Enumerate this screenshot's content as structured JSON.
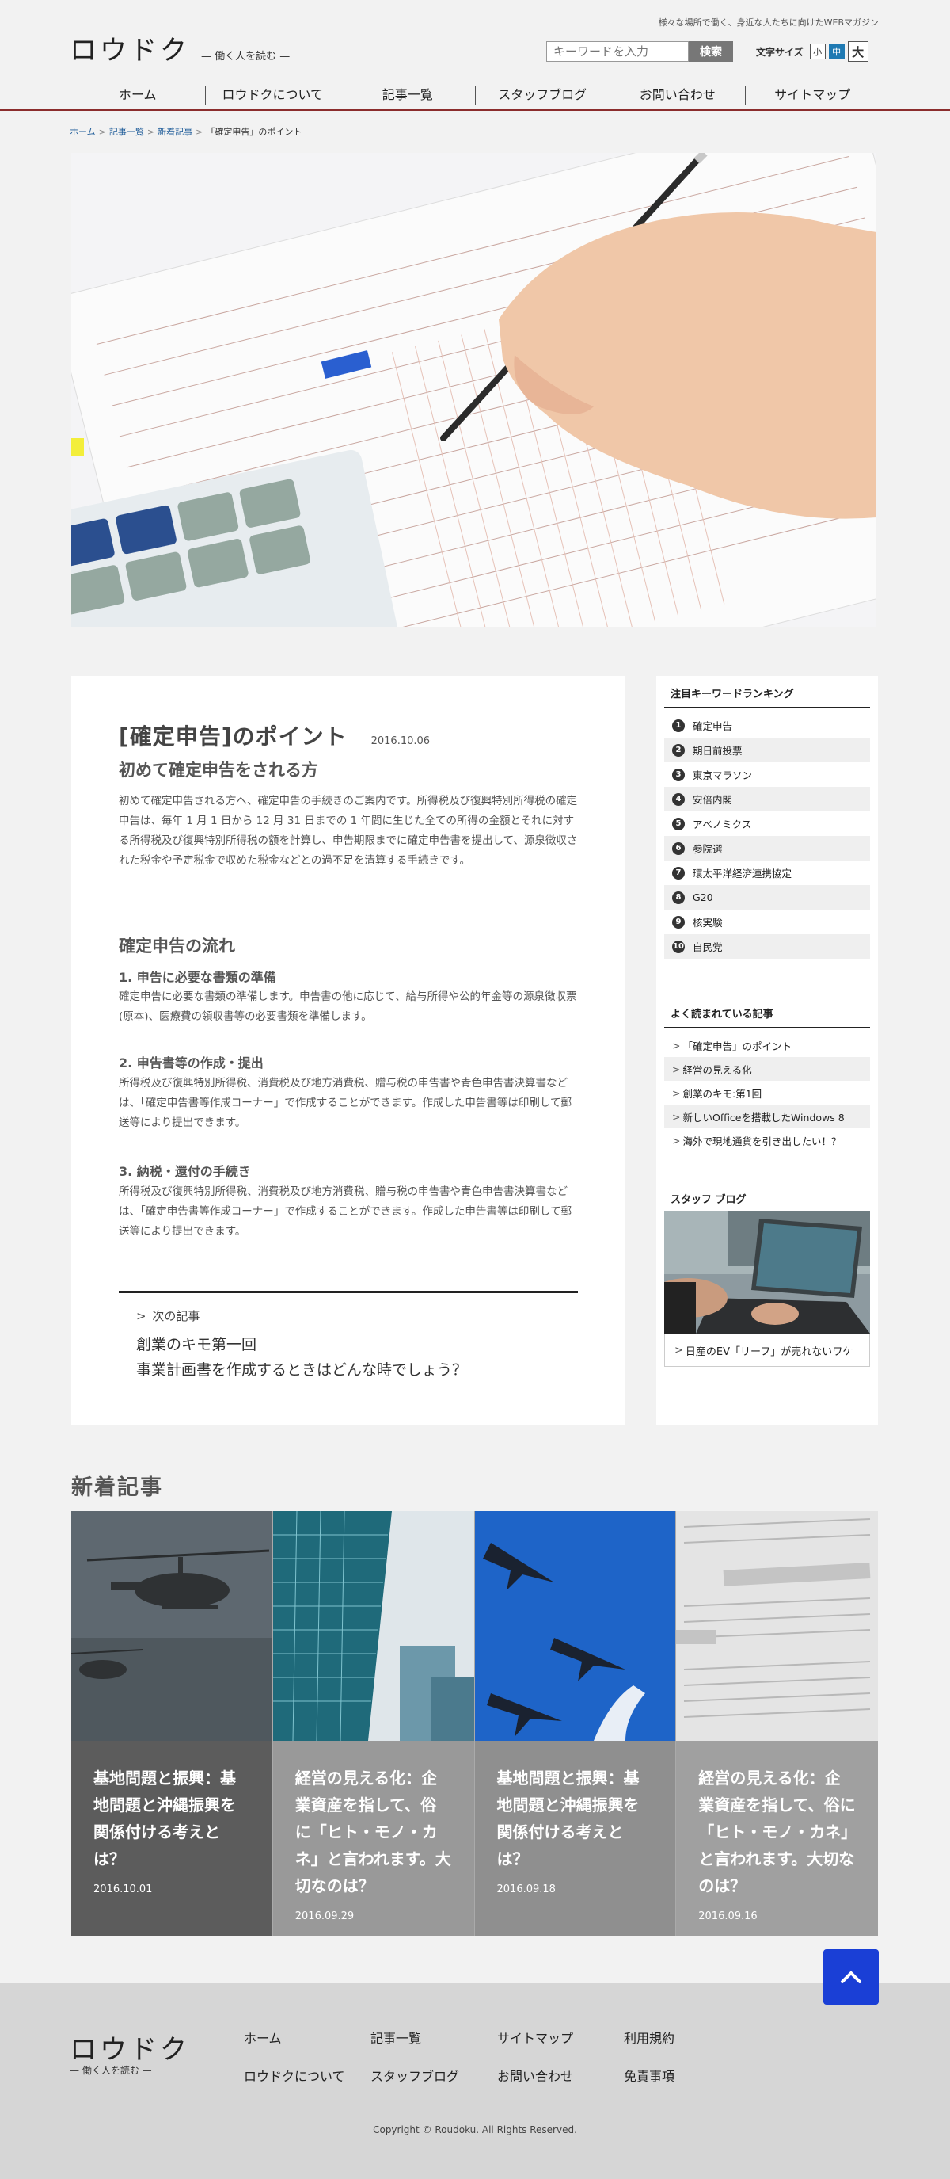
{
  "site": {
    "logo": "ロウドク",
    "subtitle": "— 働く人を読む —",
    "tagline": "様々な場所で働く、身近な人たちに向けたWEBマガジン"
  },
  "search": {
    "placeholder": "キーワードを入力",
    "button_label": "検索"
  },
  "font_size": {
    "label": "文字サイズ",
    "small": "小",
    "medium": "中",
    "large": "大"
  },
  "nav": [
    "ホーム",
    "ロウドクについて",
    "記事一覧",
    "スタッフブログ",
    "お問い合わせ",
    "サイトマップ"
  ],
  "breadcrumb": [
    "ホーム",
    "記事一覧",
    "新着記事",
    "「確定申告」のポイント"
  ],
  "article": {
    "title": "[確定申告]のポイント",
    "date": "2016.10.06",
    "section1_heading": "初めて確定申告をされる方",
    "section1_body": "初めて確定申告される方へ、確定申告の手続きのご案内です。所得税及び復興特別所得税の確定申告は、毎年 1 月 1 日から 12 月 31 日までの 1 年間に生じた全ての所得の金額とそれに対する所得税及び復興特別所得税の額を計算し、申告期限までに確定申告書を提出して、源泉徴収された税金や予定税金で収めた税金などとの過不足を清算する手続きです。",
    "section2_heading": "確定申告の流れ",
    "step1_heading": "1. 申告に必要な書類の準備",
    "step1_body": "確定申告に必要な書類の準備します。申告書の他に応じて、給与所得や公的年金等の源泉徴収票(原本)、医療費の領収書等の必要書類を準備します。",
    "step2_heading": "2. 申告書等の作成・提出",
    "step2_body": "所得税及び復興特別所得税、消費税及び地方消費税、贈与税の申告書や青色申告書決算書などは、「確定申告書等作成コーナー」で作成することができます。作成した申告書等は印刷して郵送等により提出できます。",
    "step3_heading": "3. 納税・還付の手続き",
    "step3_body": "所得税及び復興特別所得税、消費税及び地方消費税、贈与税の申告書や青色申告書決算書などは、「確定申告書等作成コーナー」で作成することができます。作成した申告書等は印刷して郵送等により提出できます。",
    "next_label": "次の記事",
    "next_title_line1": "創業のキモ第一回",
    "next_title_line2": "事業計画書を作成するときはどんな時でしょう？"
  },
  "sidebar": {
    "ranking_title": "注目キーワードランキング",
    "ranking": [
      {
        "num": "1",
        "label": "確定申告"
      },
      {
        "num": "2",
        "label": "期日前投票"
      },
      {
        "num": "3",
        "label": "東京マラソン"
      },
      {
        "num": "4",
        "label": "安倍内閣"
      },
      {
        "num": "5",
        "label": "アベノミクス"
      },
      {
        "num": "6",
        "label": "参院選"
      },
      {
        "num": "7",
        "label": "環太平洋経済連携協定"
      },
      {
        "num": "8",
        "label": "G20"
      },
      {
        "num": "9",
        "label": "核実験"
      },
      {
        "num": "10",
        "label": "自民党"
      }
    ],
    "popular_title": "よく読まれている記事",
    "popular": [
      "「確定申告」のポイント",
      "経営の見える化",
      "創業のキモ:第1回",
      "新しいOfficeを搭載したWindows 8",
      "海外で現地通貨を引き出したい！？"
    ],
    "blog_title": "スタッフ ブログ",
    "blog_caption": "日産のEV「リーフ」が売れないワケ"
  },
  "new_articles": {
    "heading": "新着記事",
    "items": [
      {
        "title": "基地問題と振興：基地問題と沖縄振興を関係付ける考えとは？",
        "date": "2016.10.01",
        "bg": "#5c5c5c"
      },
      {
        "title": "経営の見える化：企業資産を指して、俗に「ヒト・モノ・カネ」と言われます。大切なのは？",
        "date": "2016.09.29",
        "bg": "#999999"
      },
      {
        "title": "基地問題と振興：基地問題と沖縄振興を関係付ける考えとは？",
        "date": "2016.09.18",
        "bg": "#8f8f8f"
      },
      {
        "title": "経営の見える化：企業資産を指して、俗に「ヒト・モノ・カネ」と言われます。大切なのは？",
        "date": "2016.09.16",
        "bg": "#a0a0a0"
      }
    ]
  },
  "footer": {
    "logo": "ロウドク",
    "subtitle": "— 働く人を読む —",
    "links": [
      "ホーム",
      "記事一覧",
      "サイトマップ",
      "利用規約",
      "ロウドクについて",
      "スタッフブログ",
      "お問い合わせ",
      "免責事項"
    ],
    "copyright": "Copyright © Roudoku. All Rights Reserved."
  },
  "colors": {
    "accent_line": "#8b2d2d",
    "font_active": "#1f7ab3",
    "to_top": "#1a3fd6"
  }
}
